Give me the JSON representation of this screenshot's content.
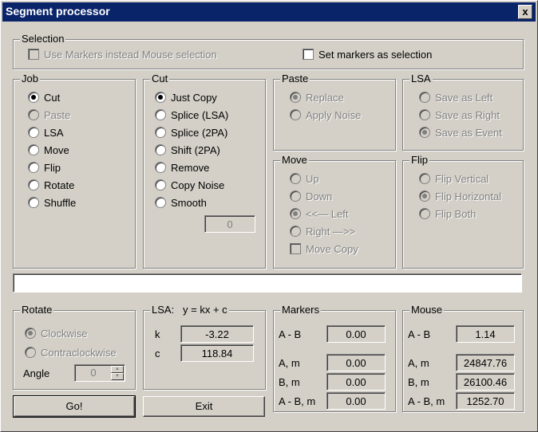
{
  "window": {
    "title": "Segment processor",
    "close_label": "x"
  },
  "selection": {
    "legend": "Selection",
    "use_markers_label": "Use Markers instead Mouse selection",
    "set_markers_label": "Set markers as selection"
  },
  "job": {
    "legend": "Job",
    "options": [
      "Cut",
      "Paste",
      "LSA",
      "Move",
      "Flip",
      "Rotate",
      "Shuffle"
    ],
    "selected": "Cut"
  },
  "cut": {
    "legend": "Cut",
    "options": [
      "Just Copy",
      "Splice (LSA)",
      "Splice (2PA)",
      "Shift (2PA)",
      "Remove",
      "Copy Noise",
      "Smooth"
    ],
    "selected": "Just Copy",
    "smooth_value": "0"
  },
  "paste": {
    "legend": "Paste",
    "options": [
      "Replace",
      "Apply Noise"
    ],
    "selected": "Replace"
  },
  "lsa_group": {
    "legend": "LSA",
    "options": [
      "Save as Left",
      "Save as Right",
      "Save as Event"
    ],
    "selected": "Save as Event"
  },
  "move": {
    "legend": "Move",
    "options": [
      "Up",
      "Down",
      "<<— Left",
      "Right —>>"
    ],
    "selected": "<<— Left",
    "move_copy_label": "Move Copy"
  },
  "flip": {
    "legend": "Flip",
    "options": [
      "Flip Vertical",
      "Flip Horizontal",
      "Flip Both"
    ],
    "selected": "Flip Horizontal"
  },
  "status_text": "",
  "rotate": {
    "legend": "Rotate",
    "options": [
      "Clockwise",
      "Contraclockwise"
    ],
    "selected": "Clockwise",
    "angle_label": "Angle",
    "angle_value": "0"
  },
  "lsa_fit": {
    "legend": "LSA:",
    "formula": "y = kx + c",
    "k_label": "k",
    "k_value": "-3.22",
    "c_label": "c",
    "c_value": "118.84"
  },
  "markers": {
    "legend": "Markers",
    "ab_label": "A - B",
    "ab_value": "0.00",
    "am_label": "A, m",
    "am_value": "0.00",
    "bm_label": "B, m",
    "bm_value": "0.00",
    "abm_label": "A - B, m",
    "abm_value": "0.00"
  },
  "mouse": {
    "legend": "Mouse",
    "ab_label": "A - B",
    "ab_value": "1.14",
    "am_label": "A, m",
    "am_value": "24847.76",
    "bm_label": "B, m",
    "bm_value": "26100.46",
    "abm_label": "A - B, m",
    "abm_value": "1252.70"
  },
  "buttons": {
    "go_label": "Go!",
    "exit_label": "Exit"
  }
}
